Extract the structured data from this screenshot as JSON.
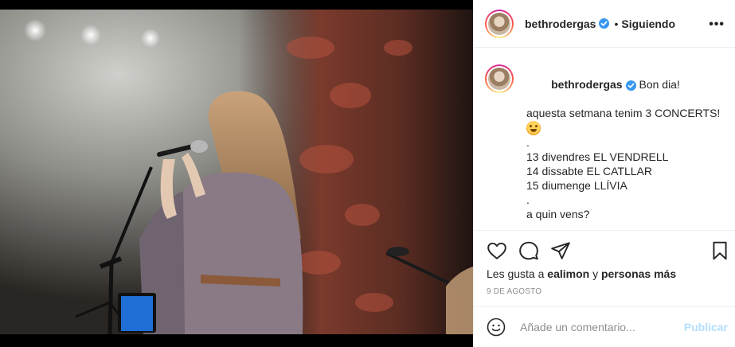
{
  "post": {
    "username": "bethrodergas",
    "follow_status": "Siguiendo",
    "dot": "•",
    "more": "•••"
  },
  "caption": {
    "username": "bethrodergas",
    "lines": [
      "Bon dia!",
      "aquesta setmana tenim 3 CONCERTS!",
      "",
      ".",
      "13 divendres EL VENDRELL",
      "14 dissabte EL CATLLAR",
      "15 diumenge LLÍVIA",
      ".",
      "a quin vens?",
      "",
      "."
    ],
    "emoji_icon": "smiling-face-with-hearts"
  },
  "likes": {
    "prefix": "Les gusta a",
    "user": "ealimon",
    "connector": "y",
    "others": "personas más"
  },
  "date": "9 DE AGOSTO",
  "comment": {
    "placeholder": "Añade un comentario...",
    "publish_label": "Publicar"
  },
  "colors": {
    "verified": "#3897f0",
    "publish_disabled": "#b2dffc",
    "muted": "#8e8e8e"
  },
  "icons": [
    "heart-icon",
    "comment-icon",
    "share-icon",
    "bookmark-icon",
    "emoji-icon",
    "verified-badge-icon",
    "more-options-icon"
  ]
}
